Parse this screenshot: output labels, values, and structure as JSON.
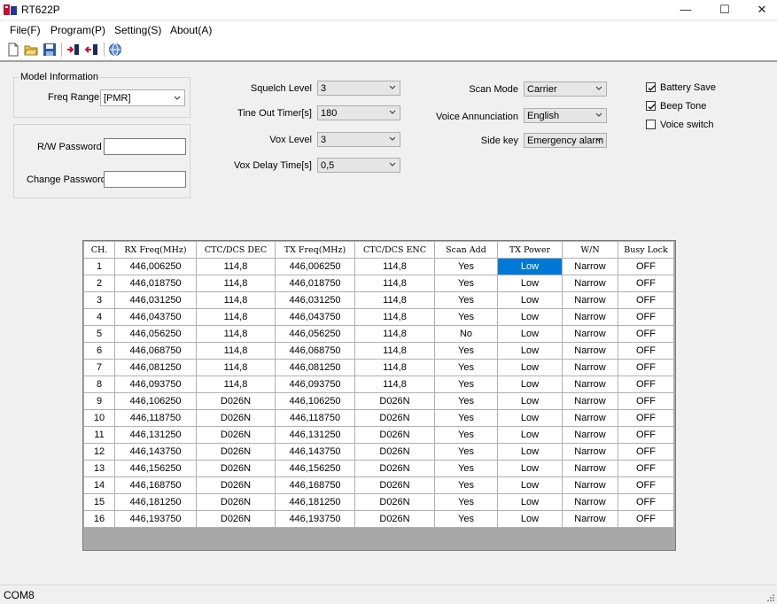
{
  "window": {
    "title": "RT622P",
    "minimize": "—",
    "maximize": "☐",
    "close": "✕"
  },
  "menu": [
    {
      "label": "File(F)"
    },
    {
      "label": "Program(P)"
    },
    {
      "label": "Setting(S)"
    },
    {
      "label": "About(A)"
    }
  ],
  "toolbar": {
    "icons": [
      "new-file-icon",
      "open-folder-icon",
      "save-icon",
      "read-radio-icon",
      "write-radio-icon",
      "settings-globe-icon"
    ]
  },
  "model_info": {
    "legend": "Model Information",
    "freq_range_label": "Freq Range",
    "freq_range_value": "[PMR]"
  },
  "password": {
    "rw_label": "R/W Password",
    "rw_value": "",
    "change_label": "Change Password",
    "change_value": ""
  },
  "settings": {
    "squelch_label": "Squelch Level",
    "squelch_value": "3",
    "tot_label": "Tine Out Timer[s]",
    "tot_value": "180",
    "vox_label": "Vox Level",
    "vox_value": "3",
    "vox_delay_label": "Vox Delay Time[s]",
    "vox_delay_value": "0,5",
    "scan_mode_label": "Scan Mode",
    "scan_mode_value": "Carrier",
    "voice_label": "Voice Annunciation",
    "voice_value": "English",
    "side_key_label": "Side key",
    "side_key_value": "Emergency alarm"
  },
  "checkboxes": [
    {
      "label": "Battery Save",
      "checked": true
    },
    {
      "label": "Beep Tone",
      "checked": true
    },
    {
      "label": "Voice switch",
      "checked": false
    }
  ],
  "table": {
    "headers": [
      "CH.",
      "RX Freq(MHz)",
      "CTC/DCS DEC",
      "TX Freq(MHz)",
      "CTC/DCS ENC",
      "Scan Add",
      "TX Power",
      "W/N",
      "Busy Lock"
    ],
    "rows": [
      [
        "1",
        "446,006250",
        "114,8",
        "446,006250",
        "114,8",
        "Yes",
        "Low",
        "Narrow",
        "OFF"
      ],
      [
        "2",
        "446,018750",
        "114,8",
        "446,018750",
        "114,8",
        "Yes",
        "Low",
        "Narrow",
        "OFF"
      ],
      [
        "3",
        "446,031250",
        "114,8",
        "446,031250",
        "114,8",
        "Yes",
        "Low",
        "Narrow",
        "OFF"
      ],
      [
        "4",
        "446,043750",
        "114,8",
        "446,043750",
        "114,8",
        "Yes",
        "Low",
        "Narrow",
        "OFF"
      ],
      [
        "5",
        "446,056250",
        "114,8",
        "446,056250",
        "114,8",
        "No",
        "Low",
        "Narrow",
        "OFF"
      ],
      [
        "6",
        "446,068750",
        "114,8",
        "446,068750",
        "114,8",
        "Yes",
        "Low",
        "Narrow",
        "OFF"
      ],
      [
        "7",
        "446,081250",
        "114,8",
        "446,081250",
        "114,8",
        "Yes",
        "Low",
        "Narrow",
        "OFF"
      ],
      [
        "8",
        "446,093750",
        "114,8",
        "446,093750",
        "114,8",
        "Yes",
        "Low",
        "Narrow",
        "OFF"
      ],
      [
        "9",
        "446,106250",
        "D026N",
        "446,106250",
        "D026N",
        "Yes",
        "Low",
        "Narrow",
        "OFF"
      ],
      [
        "10",
        "446,118750",
        "D026N",
        "446,118750",
        "D026N",
        "Yes",
        "Low",
        "Narrow",
        "OFF"
      ],
      [
        "11",
        "446,131250",
        "D026N",
        "446,131250",
        "D026N",
        "Yes",
        "Low",
        "Narrow",
        "OFF"
      ],
      [
        "12",
        "446,143750",
        "D026N",
        "446,143750",
        "D026N",
        "Yes",
        "Low",
        "Narrow",
        "OFF"
      ],
      [
        "13",
        "446,156250",
        "D026N",
        "446,156250",
        "D026N",
        "Yes",
        "Low",
        "Narrow",
        "OFF"
      ],
      [
        "14",
        "446,168750",
        "D026N",
        "446,168750",
        "D026N",
        "Yes",
        "Low",
        "Narrow",
        "OFF"
      ],
      [
        "15",
        "446,181250",
        "D026N",
        "446,181250",
        "D026N",
        "Yes",
        "Low",
        "Narrow",
        "OFF"
      ],
      [
        "16",
        "446,193750",
        "D026N",
        "446,193750",
        "D026N",
        "Yes",
        "Low",
        "Narrow",
        "OFF"
      ]
    ],
    "selected": {
      "row": 0,
      "col": 6
    },
    "selection_color": "#0078d7"
  },
  "status": {
    "text": "COM8"
  }
}
